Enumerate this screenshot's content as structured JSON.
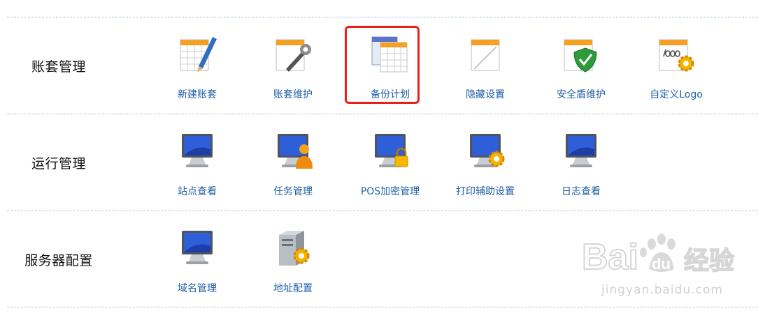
{
  "sections": [
    {
      "title": "账套管理",
      "items": [
        {
          "label": "新建账套",
          "icon": "new-account-set-icon"
        },
        {
          "label": "账套维护",
          "icon": "account-set-maintenance-icon"
        },
        {
          "label": "备份计划",
          "icon": "backup-plan-icon",
          "highlighted": true
        },
        {
          "label": "隐藏设置",
          "icon": "hidden-settings-icon"
        },
        {
          "label": "安全盾维护",
          "icon": "security-shield-icon"
        },
        {
          "label": "自定义Logo",
          "icon": "custom-logo-icon"
        }
      ]
    },
    {
      "title": "运行管理",
      "items": [
        {
          "label": "站点查看",
          "icon": "site-monitor-icon"
        },
        {
          "label": "任务管理",
          "icon": "task-monitor-user-icon"
        },
        {
          "label": "POS加密管理",
          "icon": "pos-encryption-monitor-lock-icon"
        },
        {
          "label": "打印辅助设置",
          "icon": "print-settings-monitor-gear-icon"
        },
        {
          "label": "日志查看",
          "icon": "log-monitor-icon"
        }
      ]
    },
    {
      "title": "服务器配置",
      "items": [
        {
          "label": "域名管理",
          "icon": "domain-monitor-icon"
        },
        {
          "label": "地址配置",
          "icon": "server-gear-icon"
        }
      ]
    }
  ],
  "watermark": {
    "logo_text": "Bai du 经验",
    "url": "jingyan.baidu.com"
  },
  "colors": {
    "label": "#1f5fa6",
    "divider": "#a7c4dc",
    "highlight": "#e8201b"
  }
}
